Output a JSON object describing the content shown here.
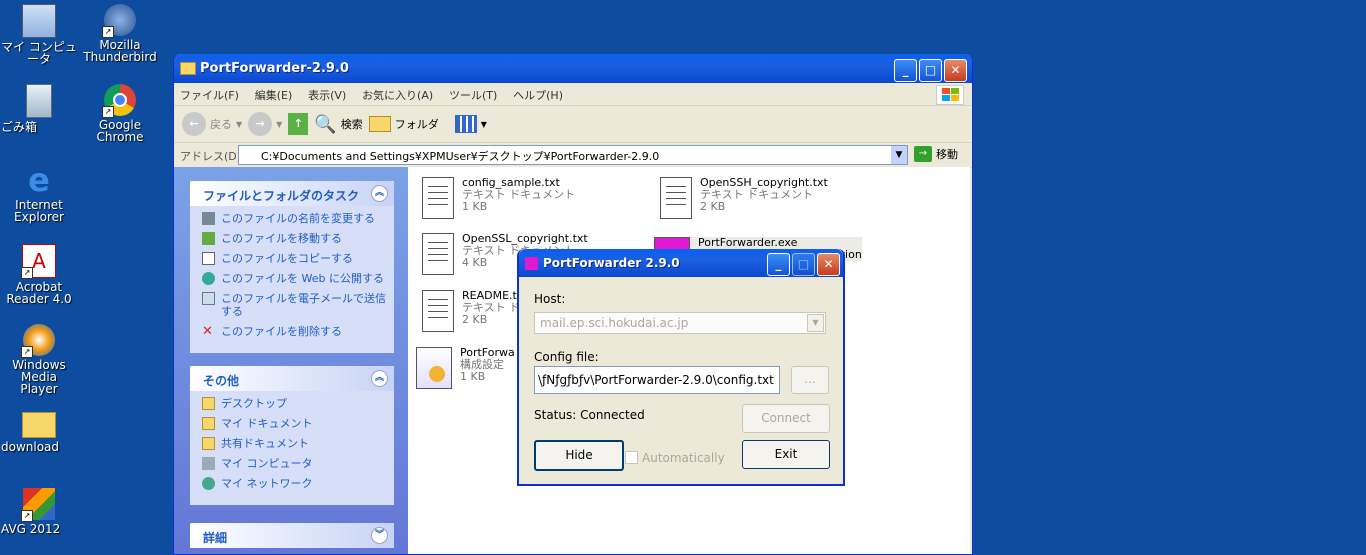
{
  "desktop": {
    "icons": [
      {
        "label": "マイ コンピュータ",
        "icon": "my-computer-icon"
      },
      {
        "label": "Mozilla Thunderbird",
        "icon": "thunderbird-icon"
      },
      {
        "label": "ごみ箱",
        "icon": "recycle-bin-icon"
      },
      {
        "label": "Google Chrome",
        "icon": "chrome-icon"
      },
      {
        "label": "Internet Explorer",
        "icon": "ie-icon"
      },
      {
        "label": "Acrobat Reader 4.0",
        "icon": "acrobat-icon"
      },
      {
        "label": "Windows Media Player",
        "icon": "media-player-icon"
      },
      {
        "label": "download",
        "icon": "folder-icon"
      },
      {
        "label": "AVG 2012",
        "icon": "avg-icon"
      }
    ]
  },
  "explorer": {
    "title": "PortForwarder-2.9.0",
    "menu": [
      "ファイル(F)",
      "編集(E)",
      "表示(V)",
      "お気に入り(A)",
      "ツール(T)",
      "ヘルプ(H)"
    ],
    "toolbar": {
      "back": "戻る",
      "search": "検索",
      "folders": "フォルダ"
    },
    "address_label": "アドレス(D)",
    "address": "C:¥Documents and Settings¥XPMUser¥デスクトップ¥PortForwarder-2.9.0",
    "go": "移動",
    "tasks": {
      "title": "ファイルとフォルダのタスク",
      "items": [
        "このファイルの名前を変更する",
        "このファイルを移動する",
        "このファイルをコピーする",
        "このファイルを Web に公開する",
        "このファイルを電子メールで送信する",
        "このファイルを削除する"
      ]
    },
    "other": {
      "title": "その他",
      "items": [
        "デスクトップ",
        "マイ ドキュメント",
        "共有ドキュメント",
        "マイ コンピュータ",
        "マイ ネットワーク"
      ]
    },
    "details": {
      "title": "詳細"
    },
    "files": [
      {
        "name": "config_sample.txt",
        "type": "テキスト ドキュメント",
        "size": "1 KB"
      },
      {
        "name": "OpenSSH_copyright.txt",
        "type": "テキスト ドキュメント",
        "size": "2 KB"
      },
      {
        "name": "OpenSSL_copyright.txt",
        "type": "テキスト ドキュメント",
        "size": "4 KB"
      },
      {
        "name": "PortForwarder.exe",
        "type": "ation",
        "size": ""
      },
      {
        "name": "README.t",
        "type": "テキスト ドキ",
        "size": "2 KB"
      },
      {
        "name": "PortForwa",
        "type": "構成設定",
        "size": "1 KB"
      }
    ]
  },
  "dialog": {
    "title": "PortForwarder 2.9.0",
    "host_label": "Host:",
    "host_value": "mail.ep.sci.hokudai.ac.jp",
    "config_label": "Config file:",
    "config_value": "\\ƒNƒgƒbƒv\\PortForwarder-2.9.0\\config.txt",
    "browse_label": "...",
    "status": "Status: Connected",
    "connect_label": "Connect",
    "hide_label": "Hide",
    "auto_label": "Automatically",
    "exit_label": "Exit"
  }
}
